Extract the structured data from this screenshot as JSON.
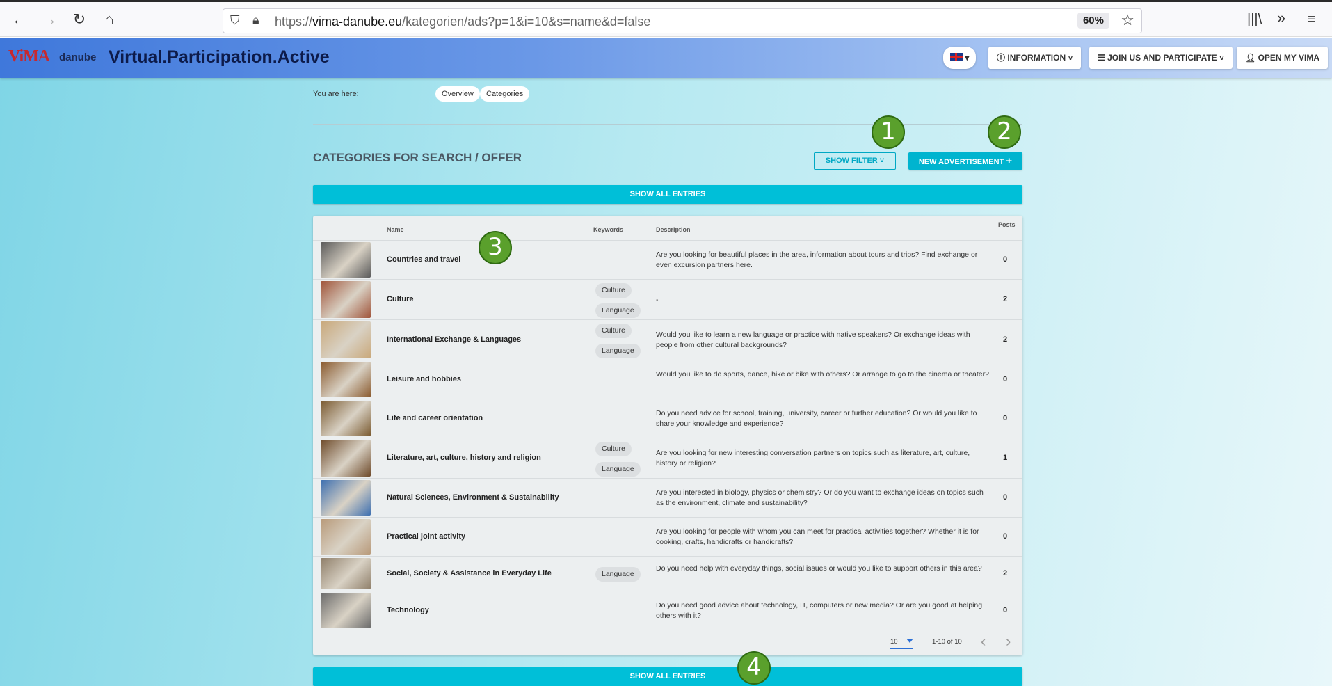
{
  "browser": {
    "url_prefix": "https://",
    "url_domain": "vima-danube.eu",
    "url_path": "/kategorien/ads?p=1&i=10&s=name&d=false",
    "zoom": "60%"
  },
  "header": {
    "logo_vima": "ViMA",
    "logo_danube": "danube",
    "title": "Virtual.Participation.Active",
    "language_caret": "▾",
    "information": "INFORMATION",
    "join": "JOIN US AND PARTICIPATE",
    "open_my_vima": "OPEN MY VIMA"
  },
  "breadcrumb": {
    "label": "You are here:",
    "items": [
      "Overview",
      "Categories"
    ]
  },
  "section": {
    "title": "CATEGORIES FOR SEARCH / OFFER",
    "show_filter": "SHOW FILTER",
    "new_advertisement": "NEW ADVERTISEMENT",
    "show_all_entries": "SHOW ALL ENTRIES"
  },
  "table": {
    "headers": {
      "name": "Name",
      "keywords": "Keywords",
      "description": "Description",
      "posts": "Posts"
    },
    "rows": [
      {
        "name": "Countries and travel",
        "keywords": [],
        "description": "Are you looking for beautiful places in the area, information about tours and trips? Find exchange or even excursion partners here.",
        "posts": "0",
        "thumb_color": "#5a5a5a"
      },
      {
        "name": "Culture",
        "keywords": [
          "Culture",
          "Language"
        ],
        "description": "-",
        "posts": "2",
        "thumb_color": "#a0543a"
      },
      {
        "name": "International Exchange & Languages",
        "keywords": [
          "Culture",
          "Language"
        ],
        "description": "Would you like to learn a new language or practice with native speakers? Or exchange ideas with people from other cultural backgrounds?",
        "posts": "2",
        "thumb_color": "#c9a87a"
      },
      {
        "name": "Leisure and hobbies",
        "keywords": [],
        "description": "Would you like to do sports, dance, hike or bike with others? Or arrange to go to the cinema or theater?",
        "posts": "0",
        "thumb_color": "#8a5a2e"
      },
      {
        "name": "Life and career orientation",
        "keywords": [],
        "description": "Do you need advice for school, training, university, career or further education? Or would you like to share your knowledge and experience?",
        "posts": "0",
        "thumb_color": "#7a5a30"
      },
      {
        "name": "Literature, art, culture, history and religion",
        "keywords": [
          "Culture",
          "Language"
        ],
        "description": "Are you looking for new interesting conversation partners on topics such as literature, art, culture, history or religion?",
        "posts": "1",
        "thumb_color": "#6e4a2a"
      },
      {
        "name": "Natural Sciences, Environment & Sustainability",
        "keywords": [],
        "description": "Are you interested in biology, physics or chemistry? Or do you want to exchange ideas on topics such as the environment, climate and sustainability?",
        "posts": "0",
        "thumb_color": "#3d6fb0"
      },
      {
        "name": "Practical joint activity",
        "keywords": [],
        "description": "Are you looking for people with whom you can meet for practical activities together? Whether it is for cooking, crafts, handicrafts or handicrafts?",
        "posts": "0",
        "thumb_color": "#b89a7a"
      },
      {
        "name": "Social, Society & Assistance in Everyday Life",
        "keywords": [
          "Language"
        ],
        "description": "Do you need help with everyday things, social issues or would you like to support others in this area?",
        "posts": "2",
        "thumb_color": "#8f7f6a"
      },
      {
        "name": "Technology",
        "keywords": [],
        "description": "Do you need good advice about technology, IT, computers or new media? Or are you good at helping others with it?",
        "posts": "0",
        "thumb_color": "#6a6a6a"
      }
    ],
    "pager": {
      "per_page": "10",
      "range": "1-10 of 10"
    }
  },
  "markers": [
    "1",
    "2",
    "3",
    "4"
  ],
  "colors": {
    "accent": "#00bfd8",
    "marker": "#5aa02c",
    "header_start": "#3f78db"
  }
}
